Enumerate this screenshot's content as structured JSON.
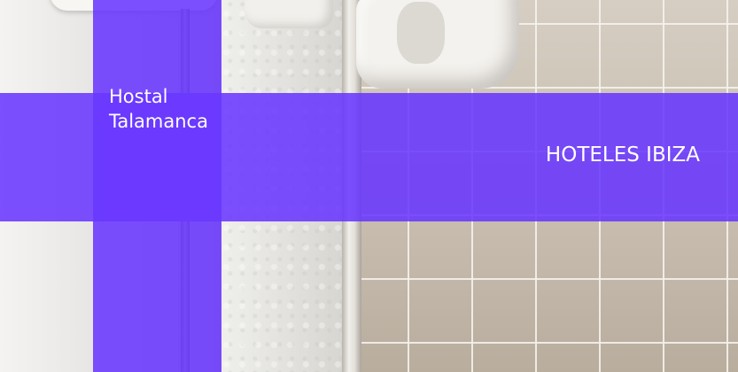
{
  "hotel": {
    "name": "Hostal Talamanca"
  },
  "category": {
    "label": "HOTELES IBIZA"
  },
  "colors": {
    "overlay": "#6633ff",
    "text": "#ffffff"
  }
}
